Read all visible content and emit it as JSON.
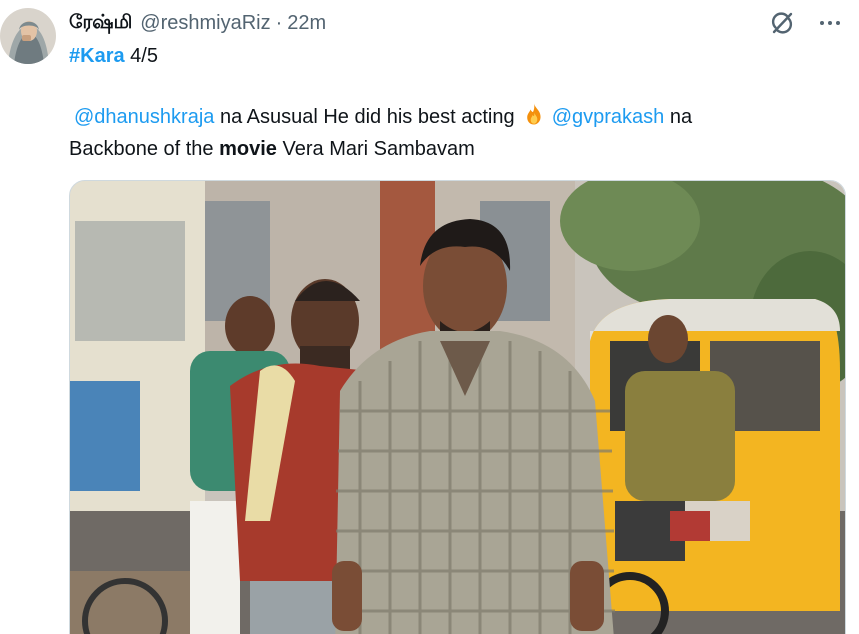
{
  "tweet": {
    "display_name": "ரேஷ்மி",
    "handle": "@reshmiyaRiz",
    "separator": "·",
    "timestamp": "22m",
    "hashtag": "#Kara",
    "rating": "4/5",
    "mention_1": "@dhanushkraja",
    "text_part_1": "na Asusual He did his best acting",
    "emoji": "fire",
    "mention_2": "@gvprakash",
    "text_part_2": "na",
    "text_part_3": "Backbone of the",
    "bold_word": "movie",
    "text_part_4": "Vera Mari Sambavam"
  },
  "icons": {
    "grok": "grok-icon",
    "more": "more-icon"
  },
  "media": {
    "type": "photo",
    "subject": "film still"
  },
  "colors": {
    "link": "#1d9bf0",
    "secondary_text": "#536471",
    "primary_text": "#0f1419"
  }
}
